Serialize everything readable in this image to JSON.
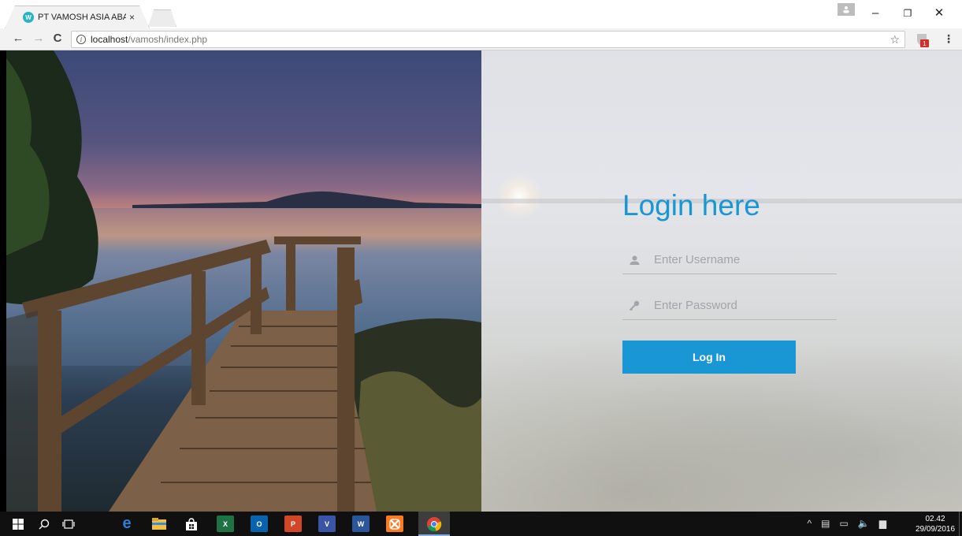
{
  "browser": {
    "tab_title": "PT VAMOSH ASIA ABADI",
    "tab_close": "×",
    "favicon_letter": "W",
    "url_host": "localhost",
    "url_path": "/vamosh/index.php",
    "extension_badge": "1"
  },
  "window_controls": {
    "minimize": "–",
    "maximize": "❐",
    "close": "✕"
  },
  "login": {
    "title": "Login here",
    "username_placeholder": "Enter Username",
    "password_placeholder": "Enter Password",
    "button_label": "Log In"
  },
  "taskbar": {
    "clock_time": "02.42",
    "clock_date": "29/09/2016",
    "apps": [
      {
        "name": "edge",
        "label": "e",
        "color": "#2a7fd4"
      },
      {
        "name": "file-explorer",
        "label": "",
        "color": "#f0c040"
      },
      {
        "name": "store",
        "label": "",
        "color": "#ffffff"
      },
      {
        "name": "excel",
        "label": "X",
        "color": "#1f7244"
      },
      {
        "name": "outlook",
        "label": "O",
        "color": "#0a64ad"
      },
      {
        "name": "powerpoint",
        "label": "P",
        "color": "#d24726"
      },
      {
        "name": "visio",
        "label": "V",
        "color": "#3955a3"
      },
      {
        "name": "word",
        "label": "W",
        "color": "#2b579a"
      },
      {
        "name": "xampp",
        "label": "",
        "color": "#fb7a24"
      },
      {
        "name": "chrome",
        "label": "",
        "color": "#db4437"
      }
    ]
  },
  "colors": {
    "accent": "#1996d4",
    "placeholder": "#a3a4a7"
  }
}
